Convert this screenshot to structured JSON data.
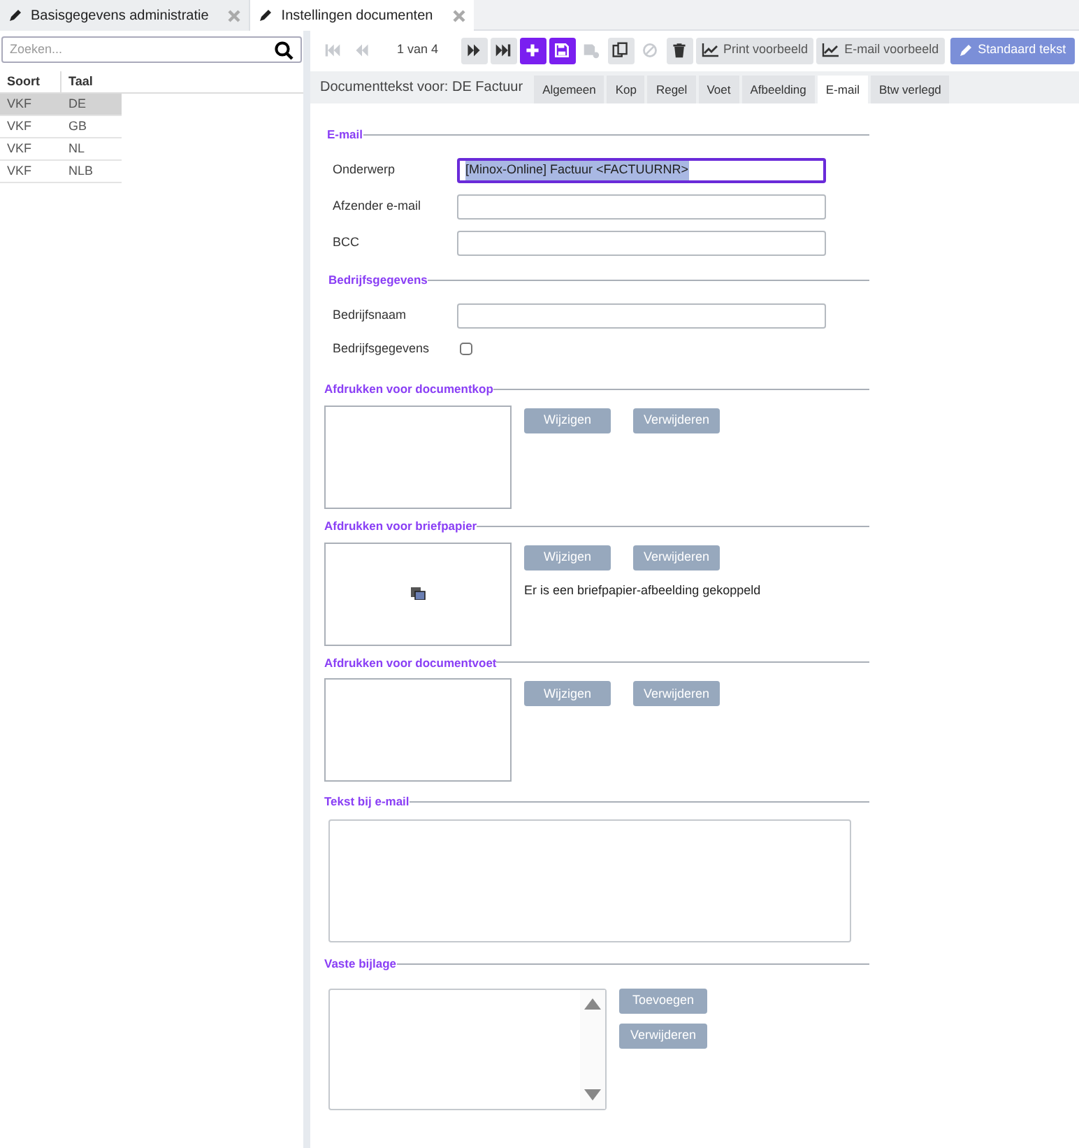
{
  "app_tabs": [
    {
      "label": "Basisgegevens administratie",
      "selected": false
    },
    {
      "label": "Instellingen documenten",
      "selected": true
    }
  ],
  "search": {
    "placeholder": "Zoeken..."
  },
  "table": {
    "columns": [
      "Soort",
      "Taal"
    ],
    "rows": [
      {
        "cells": [
          "VKF",
          "DE"
        ],
        "selected": true
      },
      {
        "cells": [
          "VKF",
          "GB"
        ],
        "selected": false
      },
      {
        "cells": [
          "VKF",
          "NL"
        ],
        "selected": false
      },
      {
        "cells": [
          "VKF",
          "NLB"
        ],
        "selected": false
      }
    ]
  },
  "toolbar": {
    "pager": "1 van 4",
    "buttons": [
      {
        "kind": "first",
        "disabled": true
      },
      {
        "kind": "prev",
        "disabled": true
      },
      {
        "kind": "pager"
      },
      {
        "kind": "next",
        "disabled": false
      },
      {
        "kind": "last",
        "disabled": false
      },
      {
        "kind": "add"
      },
      {
        "kind": "save"
      },
      {
        "kind": "saveas",
        "disabled": true
      },
      {
        "kind": "copy",
        "disabled": false
      },
      {
        "kind": "cancel",
        "disabled": true
      },
      {
        "kind": "delete",
        "disabled": false
      },
      {
        "kind": "chart",
        "label": "Print voorbeeld"
      },
      {
        "kind": "chart",
        "label": "E-mail voorbeeld"
      },
      {
        "kind": "primary",
        "label": "Standaard tekst"
      }
    ]
  },
  "document_header": "Documenttekst voor: DE Factuur",
  "sub_tabs": [
    {
      "label": "Algemeen",
      "selected": false
    },
    {
      "label": "Kop",
      "selected": false
    },
    {
      "label": "Regel",
      "selected": false
    },
    {
      "label": "Voet",
      "selected": false
    },
    {
      "label": "Afbeelding",
      "selected": false
    },
    {
      "label": "E-mail",
      "selected": true
    },
    {
      "label": "Btw verlegd",
      "selected": false
    }
  ],
  "sections": [
    {
      "kind": "fields",
      "title": "E-mail",
      "fields": [
        {
          "kind": "text",
          "label": "Onderwerp",
          "value": "[Minox-Online] Factuur <FACTUURNR>",
          "focused": true
        },
        {
          "kind": "text",
          "label": "Afzender e-mail",
          "focused": false
        },
        {
          "kind": "text",
          "label": "BCC",
          "focused": false
        }
      ]
    },
    {
      "kind": "fields",
      "title": "Bedrijfsgegevens",
      "fields": [
        {
          "kind": "text",
          "label": "Bedrijfsnaam",
          "focused": false
        },
        {
          "kind": "checkbox",
          "label": "Bedrijfsgegevens",
          "checked": false
        }
      ]
    },
    {
      "kind": "image",
      "title": "Afdrukken voor documentkop",
      "buttons": [
        "Wijzigen",
        "Verwijderen"
      ],
      "has_image": false
    },
    {
      "kind": "image",
      "title": "Afdrukken voor briefpapier",
      "buttons": [
        "Wijzigen",
        "Verwijderen"
      ],
      "has_image": true,
      "note": "Er is een briefpapier-afbeelding gekoppeld"
    },
    {
      "kind": "image",
      "title": "Afdrukken voor documentvoet",
      "buttons": [
        "Wijzigen",
        "Verwijderen"
      ],
      "has_image": false
    },
    {
      "kind": "textarea",
      "title": "Tekst bij e-mail"
    },
    {
      "kind": "attachments",
      "title": "Vaste bijlage",
      "buttons": [
        "Toevoegen",
        "Verwijderen"
      ]
    }
  ]
}
